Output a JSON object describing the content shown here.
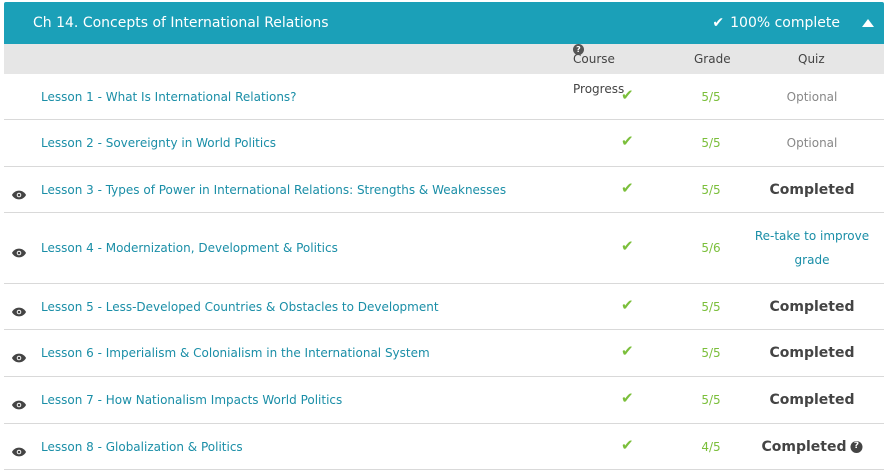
{
  "chapter": {
    "title": "Ch 14. Concepts of International Relations",
    "status": "100% complete"
  },
  "columns": {
    "progress": "Course Progress",
    "grade": "Grade",
    "quiz": "Quiz"
  },
  "colors": {
    "header": "#1ba0b8",
    "link": "#1a8ea7",
    "success": "#7bbf3b"
  },
  "lessons": [
    {
      "title": "Lesson 1 - What Is International Relations?",
      "grade": "5/5",
      "quiz": "Optional",
      "quiz_type": "optional",
      "viewed": false
    },
    {
      "title": "Lesson 2 - Sovereignty in World Politics",
      "grade": "5/5",
      "quiz": "Optional",
      "quiz_type": "optional",
      "viewed": false
    },
    {
      "title": "Lesson 3 - Types of Power in International Relations: Strengths & Weaknesses",
      "grade": "5/5",
      "quiz": "Completed",
      "quiz_type": "completed",
      "viewed": true
    },
    {
      "title": "Lesson 4 - Modernization, Development & Politics",
      "grade": "5/6",
      "quiz": "Re-take to improve grade",
      "quiz_type": "retake",
      "viewed": true
    },
    {
      "title": "Lesson 5 - Less-Developed Countries & Obstacles to Development",
      "grade": "5/5",
      "quiz": "Completed",
      "quiz_type": "completed",
      "viewed": true
    },
    {
      "title": "Lesson 6 - Imperialism & Colonialism in the International System",
      "grade": "5/5",
      "quiz": "Completed",
      "quiz_type": "completed",
      "viewed": true
    },
    {
      "title": "Lesson 7 - How Nationalism Impacts World Politics",
      "grade": "5/5",
      "quiz": "Completed",
      "quiz_type": "completed",
      "viewed": true
    },
    {
      "title": "Lesson 8 - Globalization & Politics",
      "grade": "4/5",
      "quiz": "Completed",
      "quiz_type": "completed_help",
      "viewed": true
    }
  ]
}
